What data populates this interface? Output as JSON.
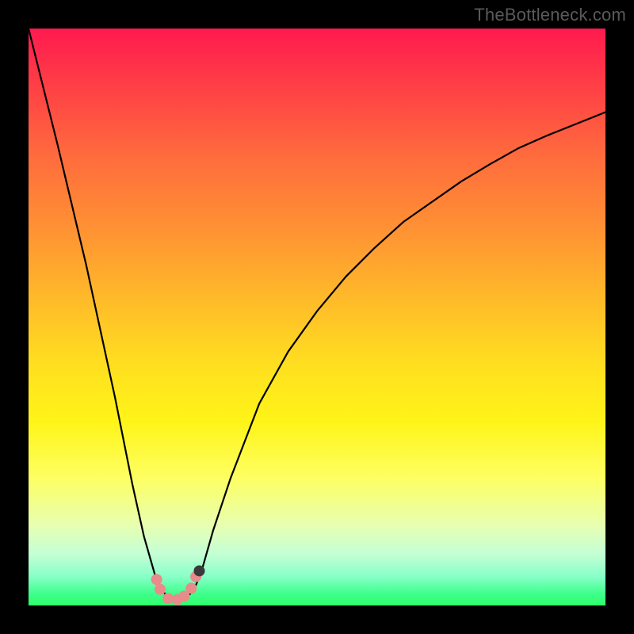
{
  "watermark": "TheBottleneck.com",
  "chart_data": {
    "type": "line",
    "title": "",
    "xlabel": "",
    "ylabel": "",
    "xlim": [
      0,
      100
    ],
    "ylim": [
      0,
      100
    ],
    "series": [
      {
        "name": "curve",
        "x": [
          0,
          5,
          10,
          15,
          18,
          20,
          22,
          23,
          24,
          25,
          26,
          27,
          28,
          29,
          30,
          32,
          35,
          40,
          45,
          50,
          55,
          60,
          65,
          70,
          75,
          80,
          85,
          90,
          95,
          100
        ],
        "y": [
          100,
          80,
          59,
          36,
          21,
          12,
          5,
          3,
          1.5,
          1,
          1,
          1.2,
          2,
          3.5,
          6,
          13,
          22,
          35,
          44,
          51,
          57,
          62,
          66.5,
          70,
          73.5,
          76.5,
          79.3,
          81.5,
          83.5,
          85.5
        ],
        "color": "#000000"
      }
    ],
    "markers": [
      {
        "name": "dot-left-1",
        "x": 22.2,
        "y": 4.5,
        "color": "#e88b8b"
      },
      {
        "name": "dot-left-2",
        "x": 22.8,
        "y": 2.8,
        "color": "#e88b8b"
      },
      {
        "name": "dot-bottom-1",
        "x": 24.2,
        "y": 1.2,
        "color": "#e88b8b"
      },
      {
        "name": "dot-bottom-2",
        "x": 25.8,
        "y": 1.0,
        "color": "#e88b8b"
      },
      {
        "name": "dot-bottom-3",
        "x": 27.0,
        "y": 1.6,
        "color": "#e88b8b"
      },
      {
        "name": "dot-right-1",
        "x": 28.2,
        "y": 3.0,
        "color": "#e88b8b"
      },
      {
        "name": "dot-right-2",
        "x": 29.0,
        "y": 5.0,
        "color": "#e88b8b"
      },
      {
        "name": "dot-dark",
        "x": 29.6,
        "y": 6.0,
        "color": "#3a3a3a"
      }
    ],
    "background_gradient": {
      "top": "#ff1a4f",
      "mid": "#ffe418",
      "bottom": "#2eff68"
    }
  }
}
